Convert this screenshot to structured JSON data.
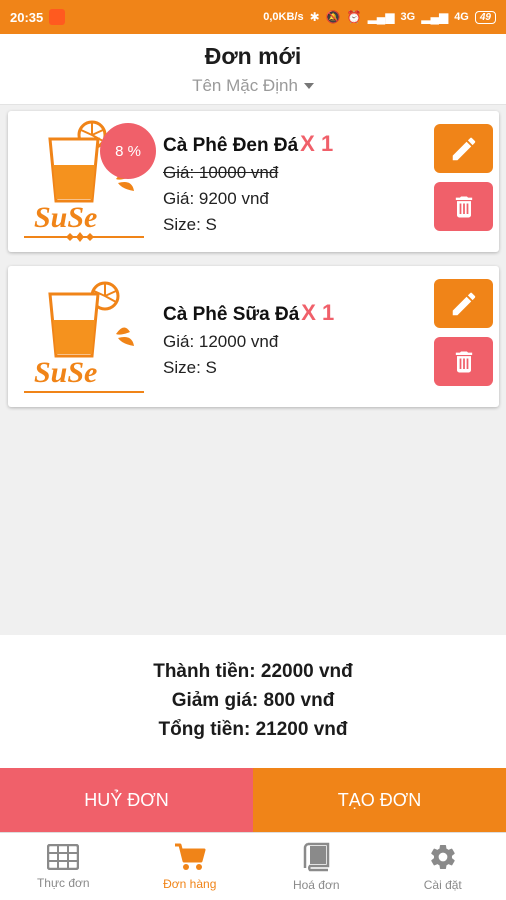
{
  "status_bar": {
    "time": "20:35",
    "network_speed": "0,0KB/s",
    "signal_3g": "3G",
    "signal_4g": "4G",
    "battery": "49"
  },
  "header": {
    "title": "Đơn mới",
    "picker_value": "Tên Mặc Định"
  },
  "items": [
    {
      "name": "Cà Phê Đen Đá",
      "qty": "X 1",
      "discount_badge": "8 %",
      "price_original": "Giá: 10000 vnđ",
      "price_final": "Giá: 9200 vnđ",
      "size": "Size: S",
      "logo_text": "SuSe"
    },
    {
      "name": "Cà Phê Sữa Đá",
      "qty": "X 1",
      "price": "Giá: 12000 vnđ",
      "size": "Size: S",
      "logo_text": "SuSe"
    }
  ],
  "summary": {
    "subtotal": "Thành tiền: 22000 vnđ",
    "discount": "Giảm giá: 800 vnđ",
    "total": "Tổng tiền: 21200 vnđ"
  },
  "actions": {
    "cancel_label": "HUỶ ĐƠN",
    "create_label": "TẠO ĐƠN"
  },
  "nav": [
    {
      "label": "Thực đơn",
      "icon": "grid-icon"
    },
    {
      "label": "Đơn hàng",
      "icon": "cart-icon",
      "active": true
    },
    {
      "label": "Hoá đơn",
      "icon": "book-icon"
    },
    {
      "label": "Cài đặt",
      "icon": "gear-icon"
    }
  ],
  "colors": {
    "primary": "#f08418",
    "danger": "#f0606a",
    "background": "#f0f0f0"
  }
}
